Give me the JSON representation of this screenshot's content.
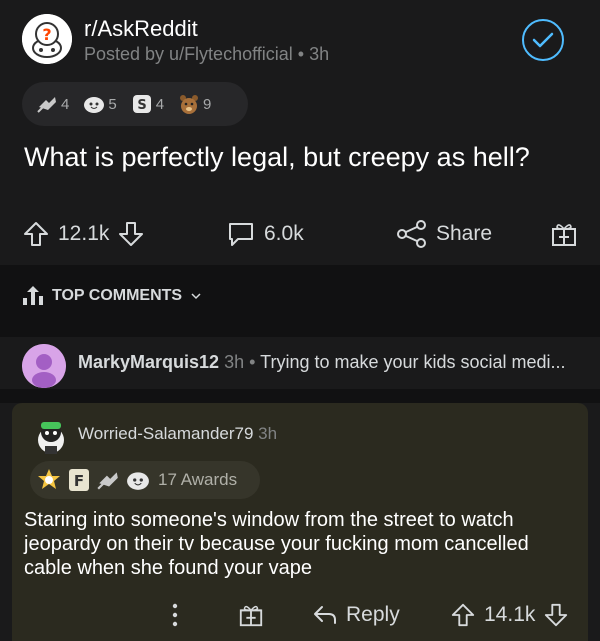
{
  "post": {
    "subreddit": "r/AskReddit",
    "posted_by": "Posted by u/Flytechofficial",
    "time": "3h",
    "awards": [
      {
        "icon": "silver-award-icon",
        "count": "4"
      },
      {
        "icon": "wholesome-award-icon",
        "count": "5"
      },
      {
        "icon": "coin-award-icon",
        "count": "4"
      },
      {
        "icon": "bear-award-icon",
        "count": "9"
      }
    ],
    "title": "What is perfectly legal, but creepy as hell?",
    "upvotes": "12.1k",
    "comments": "6.0k",
    "share_label": "Share"
  },
  "top_comments_label": "TOP COMMENTS",
  "collapsed_comment": {
    "user": "MarkyMarquis12",
    "time": "3h",
    "preview": "Trying to make your kids social medi..."
  },
  "comment": {
    "user": "Worried-Salamander79",
    "time": "3h",
    "awards_count": "17 Awards",
    "body": "Staring into someone's window from the street to watch jeopardy on their tv because your fucking mom cancelled cable when she found your vape",
    "reply_label": "Reply",
    "votes": "14.1k"
  },
  "colors": {
    "background": "#1a1a1b",
    "accent": "#4fbcff",
    "comment_highlight": "#2b2a1f"
  }
}
